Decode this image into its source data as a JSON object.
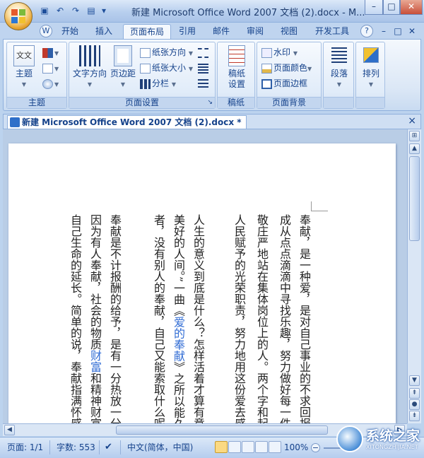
{
  "window": {
    "title": "新建 Microsoft Office Word 2007 文档 (2).docx - M...",
    "minimize": "–",
    "maximize": "□",
    "close": "✕"
  },
  "quick_access": [
    "save-icon",
    "undo-icon",
    "redo-icon",
    "print-preview-icon"
  ],
  "tabs": {
    "items": [
      "开始",
      "插入",
      "页面布局",
      "引用",
      "邮件",
      "审阅",
      "视图",
      "开发工具"
    ],
    "active": "页面布局",
    "help": "?"
  },
  "ribbon": {
    "theme_group": {
      "label": "主题",
      "theme_button": "主题",
      "theme_icon_text": "文文"
    },
    "page_setup_group": {
      "label": "页面设置",
      "text_direction": "文字方向",
      "margins": "页边距",
      "orientation": "纸张方向",
      "size": "纸张大小",
      "columns": "分栏"
    },
    "manuscript_group": {
      "label": "稿纸",
      "settings_line1": "稿纸",
      "settings_line2": "设置"
    },
    "page_background_group": {
      "label": "页面背景",
      "watermark": "水印",
      "page_color": "页面颜色",
      "page_borders": "页面边框"
    },
    "paragraph_group": {
      "label": "段落"
    },
    "arrange_group": {
      "label": "排列"
    }
  },
  "document_tab": {
    "title": "新建 Microsoft Office Word 2007 文档 (2).docx *",
    "close": "×"
  },
  "document": {
    "columns": [
      {
        "pre": "奉献，是一种爱，是对自己事业的不求回报",
        "link": "",
        "post": ""
      },
      {
        "pre": "成从点点滴滴中寻找乐趣，努力做好每一件事，认真",
        "link": "",
        "post": ""
      },
      {
        "pre": "敬庄严地站在集体岗位上的人。两个字和起来，奉",
        "link": "",
        "post": ""
      },
      {
        "pre": "人民赋予的光荣职责，努力地用这份爱去感染",
        "link": "",
        "post": ""
      },
      {
        "pre": "人生的意义到底是什么？怎样活着才算有意义",
        "link": "",
        "post": ""
      },
      {
        "pre": "美好的人间。”一曲《",
        "link": "爱的奉献",
        "post": "》之所以能久唱不衰"
      },
      {
        "pre": "者，没有别人的奉献，自己又能索取什么呢？",
        "link": "",
        "post": ""
      },
      {
        "pre": "奉献是不计报酬的给予，是有一分热放一分",
        "link": "",
        "post": ""
      },
      {
        "pre": "因为有人奉献，社会的物质",
        "link": "财富",
        "post": "和精神财富才会不"
      },
      {
        "pre": "自己生命的延长。简单的说，奉献指满怀感情地",
        "link": "",
        "post": ""
      }
    ]
  },
  "status": {
    "page": "页面: 1/1",
    "words": "字数: 553",
    "language": "中文(简体，中国)",
    "zoom": "100%"
  },
  "watermark": {
    "brand": "系统之家",
    "url": "XITONGZHIJIA.NET"
  }
}
